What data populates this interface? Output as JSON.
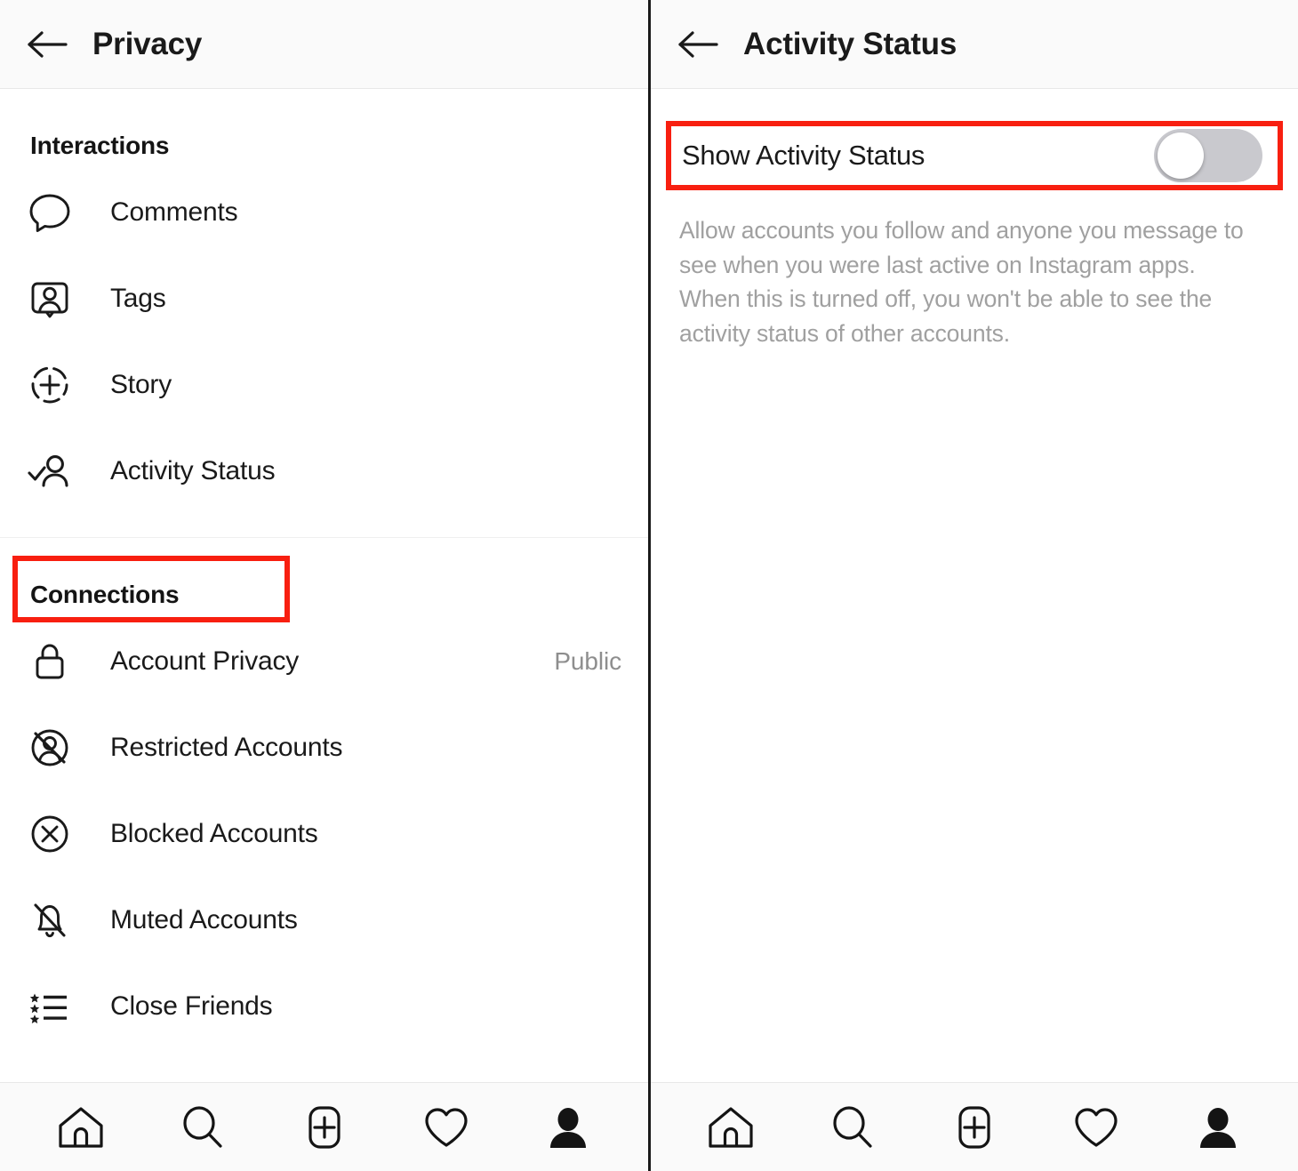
{
  "left_panel": {
    "header": {
      "back_icon": "back-arrow-icon",
      "title": "Privacy"
    },
    "sections": [
      {
        "title": "Interactions",
        "items": [
          {
            "label": "Comments",
            "icon": "comment-bubble-icon"
          },
          {
            "label": "Tags",
            "icon": "tag-person-icon"
          },
          {
            "label": "Story",
            "icon": "story-plus-circle-icon"
          },
          {
            "label": "Activity Status",
            "icon": "person-check-icon",
            "highlighted": true
          }
        ]
      },
      {
        "title": "Connections",
        "items": [
          {
            "label": "Account Privacy",
            "icon": "lock-icon",
            "value": "Public"
          },
          {
            "label": "Restricted Accounts",
            "icon": "restricted-person-icon"
          },
          {
            "label": "Blocked Accounts",
            "icon": "blocked-circle-x-icon"
          },
          {
            "label": "Muted Accounts",
            "icon": "muted-bell-icon"
          },
          {
            "label": "Close Friends",
            "icon": "close-friends-star-list-icon"
          }
        ]
      }
    ]
  },
  "right_panel": {
    "header": {
      "back_icon": "back-arrow-icon",
      "title": "Activity Status"
    },
    "toggle": {
      "label": "Show Activity Status",
      "state": "off",
      "highlighted": true
    },
    "description": "Allow accounts you follow and anyone you message to see when you were last active on Instagram apps. When this is turned off, you won't be able to see the activity status of other accounts."
  },
  "bottom_nav": {
    "items": [
      {
        "icon": "home-icon",
        "label": "Home"
      },
      {
        "icon": "search-icon",
        "label": "Search"
      },
      {
        "icon": "add-post-icon",
        "label": "Create"
      },
      {
        "icon": "heart-icon",
        "label": "Activity"
      },
      {
        "icon": "profile-icon",
        "label": "Profile"
      }
    ]
  },
  "colors": {
    "highlight": "#f81f10",
    "text_primary": "#1a1a1a",
    "text_muted": "#8e8e8e",
    "description_text": "#a0a0a0",
    "switch_track_off": "#c9c9ce",
    "header_bg": "#fafafa"
  }
}
